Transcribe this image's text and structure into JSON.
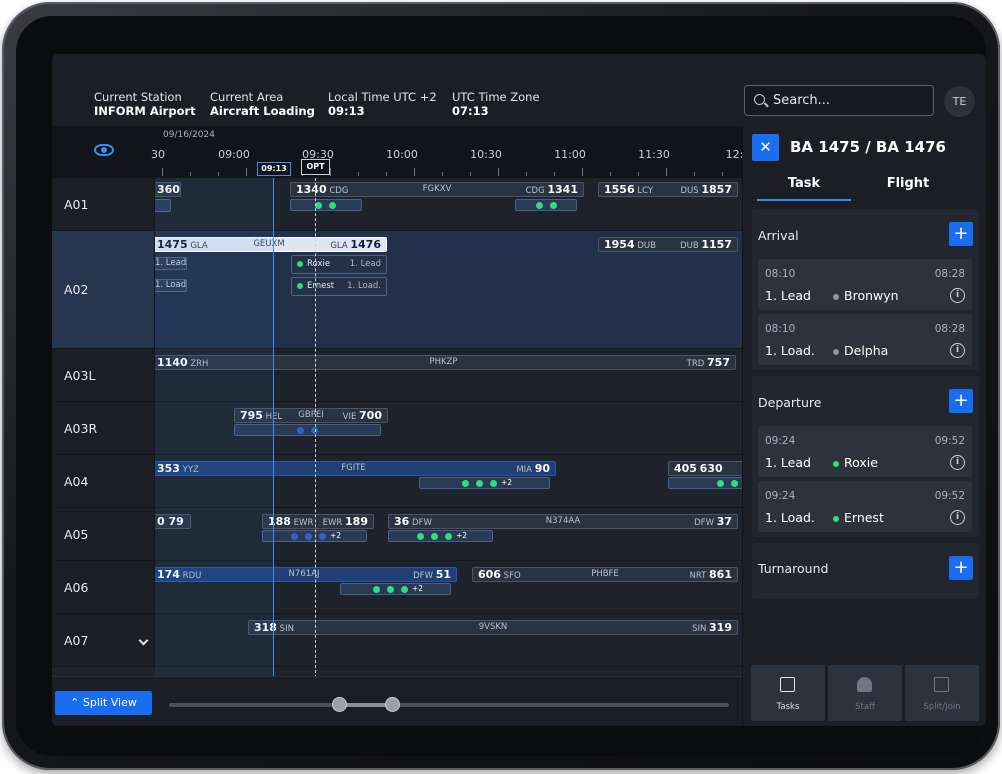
{
  "header": {
    "station_label": "Current Station",
    "station_value": "INFORM Airport",
    "area_label": "Current Area",
    "area_value": "Aircraft Loading",
    "local_label": "Local Time UTC +2",
    "local_value": "09:13",
    "utc_label": "UTC Time Zone",
    "utc_value": "07:13",
    "search_placeholder": "Search...",
    "avatar": "TE"
  },
  "timeline": {
    "date": "09/16/2024",
    "labels": [
      "30",
      "09:00",
      "09:30",
      "10:00",
      "10:30",
      "11:00",
      "11:30",
      "12:0"
    ],
    "now_flag": "09:13",
    "opt_flag": "OPT"
  },
  "rows": [
    {
      "label": "A01"
    },
    {
      "label": "A02"
    },
    {
      "label": "A03L"
    },
    {
      "label": "A03R"
    },
    {
      "label": "A04"
    },
    {
      "label": "A05"
    },
    {
      "label": "A06"
    },
    {
      "label": "A07"
    }
  ],
  "bars": {
    "a01_1": "360",
    "a01_2_n": "1340",
    "a01_2_from": "CDG",
    "a01_2_reg": "FGKXV",
    "a01_2_to": "CDG",
    "a01_2_n2": "1341",
    "a01_3_n": "1556",
    "a01_3_from": "LCY",
    "a01_3_to": "DUS",
    "a01_3_n2": "1857",
    "a02_1_n": "1475",
    "a02_1_from": "GLA",
    "a02_1_reg": "GEUXM",
    "a02_1_to": "GLA",
    "a02_1_n2": "1476",
    "a02_2_n": "1954",
    "a02_2_from": "DUB",
    "a02_2_to": "DUB",
    "a02_2_n2": "1157",
    "a02_lead": "1. Lead",
    "a02_load": "1. Load",
    "a02_task1_name": "Roxie",
    "a02_task1_role": "1. Lead",
    "a02_task2_name": "Ernest",
    "a02_task2_role": "1. Load.",
    "a03l_n": "1140",
    "a03l_from": "ZRH",
    "a03l_reg": "PHKZP",
    "a03l_to": "TRD",
    "a03l_n2": "757",
    "a03r_n": "795",
    "a03r_from": "HEL",
    "a03r_reg": "GBPEI",
    "a03r_to": "VIE",
    "a03r_n2": "700",
    "a04_1_n": "353",
    "a04_1_from": "YYZ",
    "a04_1_reg": "FGITE",
    "a04_1_to": "MIA",
    "a04_1_n2": "90",
    "a04_2_n": "405",
    "a04_2_n2": "630",
    "a05_1": "0  79",
    "a05_2_n": "188",
    "a05_2_from": "EWR",
    "a05_2_to": "EWR",
    "a05_2_n2": "189",
    "a05_3_n": "36",
    "a05_3_from": "DFW",
    "a05_3_reg": "N374AA",
    "a05_3_to": "DFW",
    "a05_3_n2": "37",
    "a06_1_n": "174",
    "a06_1_from": "RDU",
    "a06_1_reg": "N761AJ",
    "a06_1_to": "DFW",
    "a06_1_n2": "51",
    "a06_2_n": "606",
    "a06_2_from": "SFO",
    "a06_2_reg": "PHBFE",
    "a06_2_to": "NRT",
    "a06_2_n2": "861",
    "a07_n": "318",
    "a07_from": "SIN",
    "a07_reg": "9VSKN",
    "a07_to": "SIN",
    "a07_n2": "319",
    "plus": "+2"
  },
  "bottom": {
    "split_view": "Split View"
  },
  "panel": {
    "title": "BA 1475 / BA 1476",
    "tab_task": "Task",
    "tab_flight": "Flight",
    "arrival": {
      "title": "Arrival",
      "cards": [
        {
          "start": "08:10",
          "end": "08:28",
          "role": "1. Lead",
          "name": "Bronwyn"
        },
        {
          "start": "08:10",
          "end": "08:28",
          "role": "1. Load.",
          "name": "Delpha"
        }
      ]
    },
    "departure": {
      "title": "Departure",
      "cards": [
        {
          "start": "09:24",
          "end": "09:52",
          "role": "1. Lead",
          "name": "Roxie"
        },
        {
          "start": "09:24",
          "end": "09:52",
          "role": "1. Load.",
          "name": "Ernest"
        }
      ]
    },
    "turnaround": {
      "title": "Turnaround"
    },
    "buttons": {
      "tasks": "Tasks",
      "staff": "Staff",
      "split": "Split/Join"
    }
  },
  "colors": {
    "accent": "#1a6cf0",
    "ok": "#2ee07c"
  }
}
